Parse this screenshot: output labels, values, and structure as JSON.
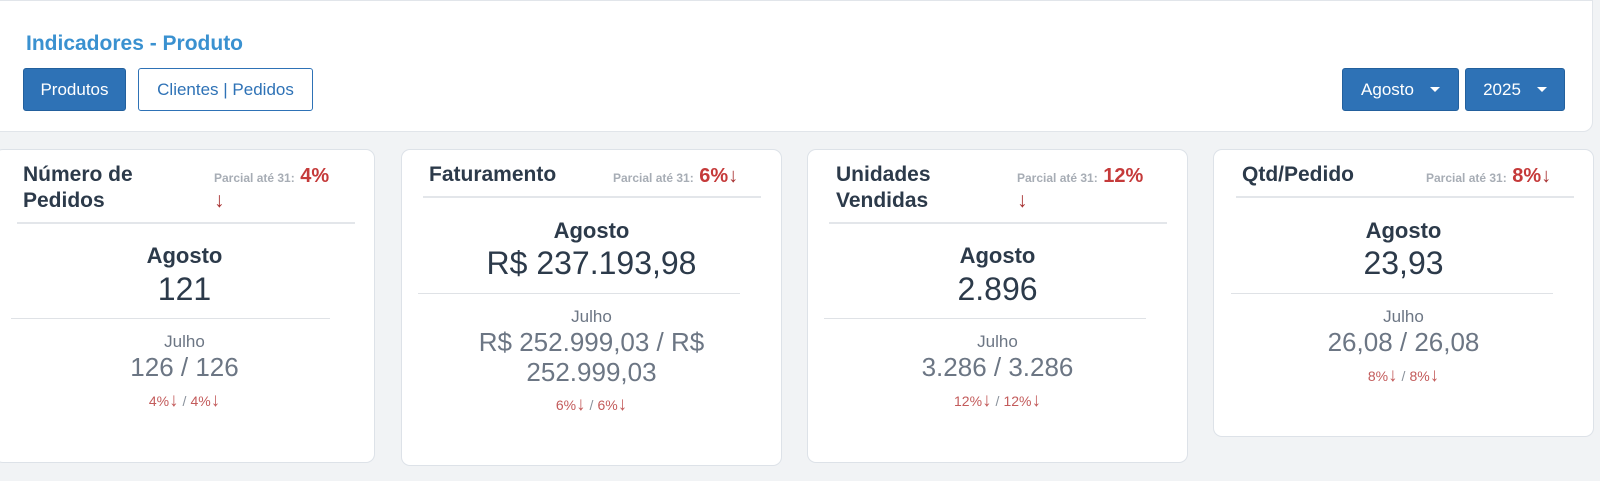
{
  "page": {
    "title": "Indicadores - Produto",
    "tabs": [
      {
        "label": "Produtos",
        "active": true
      },
      {
        "label": "Clientes | Pedidos",
        "active": false
      }
    ],
    "filters": {
      "month": "Agosto",
      "year": "2025"
    }
  },
  "icons": {
    "variation_down": "arrow-down-icon",
    "dropdown": "caret-down-icon"
  },
  "colors": {
    "accent": "#2e72b6",
    "title": "#3a91d0",
    "negative": "#c53a3a"
  },
  "cards": [
    {
      "title_line1": "Número de",
      "title_line2": "Pedidos",
      "partial_label": "Parcial até 31:",
      "partial_value": "4%",
      "arrow": "↓",
      "current_month": "Agosto",
      "current_value": "121",
      "previous_month": "Julho",
      "previous_value": "126 / 126",
      "var1": "4%",
      "var2": "4%",
      "separator": "/"
    },
    {
      "title_line1": "Faturamento",
      "partial_label": "Parcial até 31:",
      "partial_value": "6%",
      "arrow": "↓",
      "current_month": "Agosto",
      "current_value": "R$ 237.193,98",
      "previous_month": "Julho",
      "previous_value_line1": "R$ 252.999,03 / R$",
      "previous_value_line2": "252.999,03",
      "var1": "6%",
      "var2": "6%",
      "separator": "/"
    },
    {
      "title_line1": "Unidades",
      "title_line2": "Vendidas",
      "partial_label": "Parcial até 31:",
      "partial_value": "12%",
      "arrow": "↓",
      "current_month": "Agosto",
      "current_value": "2.896",
      "previous_month": "Julho",
      "previous_value": "3.286 / 3.286",
      "var1": "12%",
      "var2": "12%",
      "separator": "/"
    },
    {
      "title_line1": "Qtd/Pedido",
      "partial_label": "Parcial até 31:",
      "partial_value": "8%",
      "arrow": "↓",
      "current_month": "Agosto",
      "current_value": "23,93",
      "previous_month": "Julho",
      "previous_value": "26,08 / 26,08",
      "var1": "8%",
      "var2": "8%",
      "separator": "/"
    }
  ]
}
